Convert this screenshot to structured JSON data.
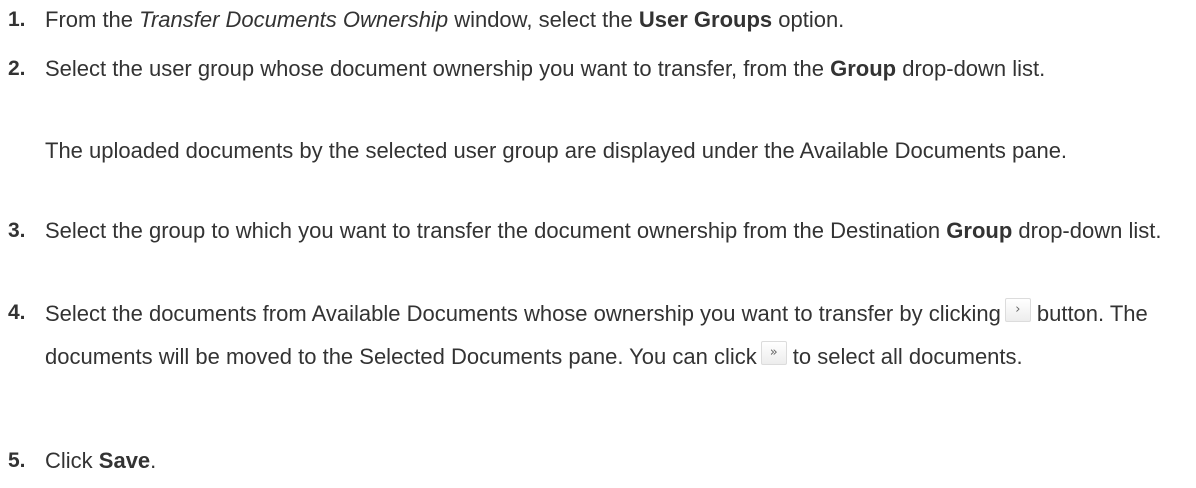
{
  "steps": [
    {
      "number": "1.",
      "p1": "From the ",
      "window_name": "Transfer Documents Ownership",
      "p2": " window, select the ",
      "option": "User Groups",
      "p3": " option."
    },
    {
      "number": "2.",
      "p1": "Select the user group whose document ownership you want to transfer, from the ",
      "field": "Group",
      "p2": " drop-down list.",
      "note": "The uploaded documents by the selected user group are displayed under the Available Documents pane."
    },
    {
      "number": "3.",
      "p1": "Select the group to which you want to transfer the document ownership from the Destination ",
      "field": "Group",
      "p2": " drop-down list."
    },
    {
      "number": "4.",
      "p1": "Select the documents from Available Documents whose ownership you want to transfer by clicking",
      "move_glyph": "›",
      "p2": "button. The documents will be moved to the Selected Documents pane. You can click",
      "move_all_glyph": "»",
      "p3": "to select all documents."
    },
    {
      "number": "5.",
      "p1": "Click ",
      "action": "Save",
      "p2": "."
    }
  ]
}
